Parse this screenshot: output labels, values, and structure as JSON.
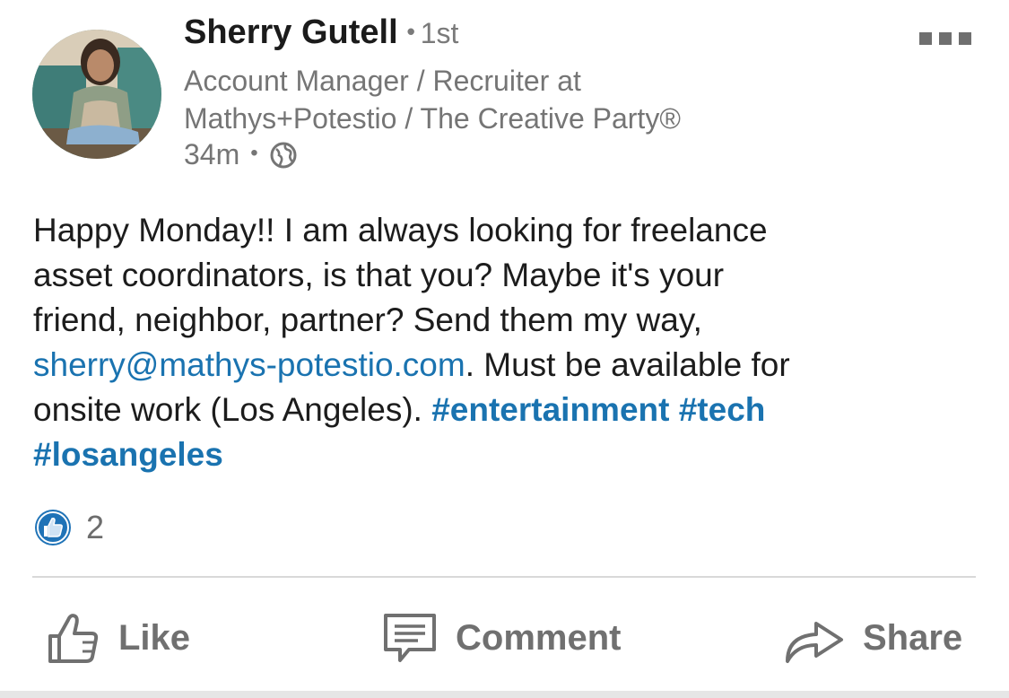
{
  "author": {
    "name": "Sherry Gutell",
    "degree_separator": "•",
    "degree": "1st",
    "headline_line1": "Account Manager / Recruiter at",
    "headline_line2": "Mathys+Potestio / The Creative Party®",
    "time": "34m",
    "meta_separator": "•",
    "visibility_icon": "globe-icon"
  },
  "menu": {
    "icon": "more-options-icon"
  },
  "post": {
    "line1": "Happy Monday!!  I am always looking for freelance",
    "line2": "asset coordinators, is that you?  Maybe it's your",
    "line3": "friend, neighbor, partner?  Send them my way,",
    "email": "sherry@mathys-potestio.com",
    "line4_rest": ".  Must be available for",
    "line5_text": "onsite work (Los Angeles). ",
    "hashtag1": "#entertainment",
    "hashtag_space": " ",
    "hashtag2": "#tech",
    "hashtag3": "#losangeles"
  },
  "reactions": {
    "icon": "thumbs-up-badge-icon",
    "count": "2"
  },
  "actions": {
    "like": {
      "label": "Like",
      "icon": "thumbs-up-icon"
    },
    "comment": {
      "label": "Comment",
      "icon": "comment-icon"
    },
    "share": {
      "label": "Share",
      "icon": "share-arrow-icon"
    }
  },
  "colors": {
    "link": "#1a73b0",
    "secondary_text": "#757575",
    "action_gray": "#707070",
    "reaction_blue": "#1f73b7"
  }
}
